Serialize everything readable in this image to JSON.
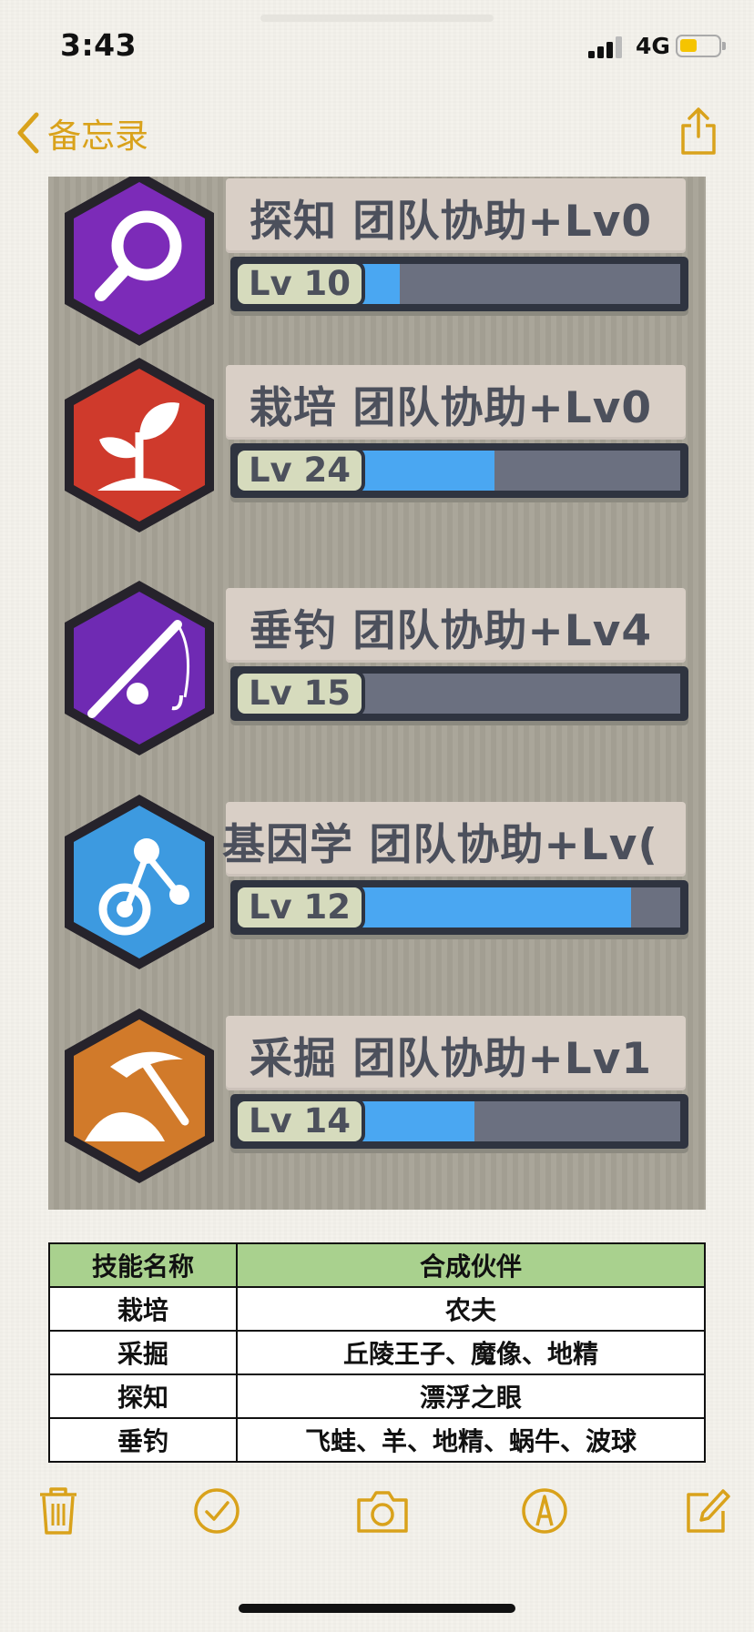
{
  "status": {
    "time": "3:43",
    "network": "4G",
    "battery_level": 0.45
  },
  "nav": {
    "back_label": "备忘录"
  },
  "colors": {
    "accent": "#d9a21b",
    "bar_fill": "#4aa7f2",
    "table_header": "#a9d18e"
  },
  "skills": [
    {
      "name": "探知 团队协助+Lv0",
      "level": "Lv 10",
      "progress": 0.14,
      "icon": "magnifier-icon"
    },
    {
      "name": "栽培 团队协助+Lv0",
      "level": "Lv 24",
      "progress": 0.43,
      "icon": "plant-icon"
    },
    {
      "name": "垂钓 团队协助+Lv4",
      "level": "Lv 15",
      "progress": 0.0,
      "icon": "fishing-rod-icon"
    },
    {
      "name": "基因学 团队协助+Lv(",
      "level": "Lv 12",
      "progress": 0.85,
      "icon": "molecule-icon"
    },
    {
      "name": "采掘 团队协助+Lv1",
      "level": "Lv 14",
      "progress": 0.37,
      "icon": "pickaxe-icon"
    }
  ],
  "table": {
    "headers": [
      "技能名称",
      "合成伙伴"
    ],
    "rows": [
      [
        "栽培",
        "农夫"
      ],
      [
        "采掘",
        "丘陵王子、魔像、地精"
      ],
      [
        "探知",
        "漂浮之眼"
      ],
      [
        "垂钓",
        "飞蛙、羊、地精、蜗牛、波球"
      ]
    ]
  },
  "toolbar": [
    "trash-icon",
    "checklist-icon",
    "camera-icon",
    "markup-icon",
    "compose-icon"
  ]
}
